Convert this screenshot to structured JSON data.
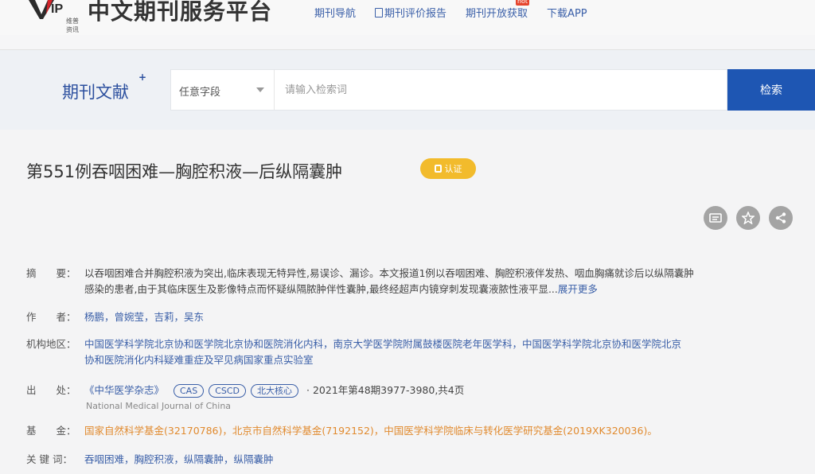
{
  "header": {
    "logo_text": "VIP",
    "logo_sub": "维普资讯",
    "site_title": "中文期刊服务平台",
    "nav": [
      {
        "label": "期刊导航"
      },
      {
        "label": "期刊评价报告"
      },
      {
        "label": "期刊开放获取",
        "badge": "hot"
      },
      {
        "label": "下载APP"
      }
    ]
  },
  "search": {
    "section_label": "期刊文献",
    "section_plus": "+",
    "field_select": "任意字段",
    "placeholder": "请输入检索词",
    "button_label": "检索"
  },
  "article": {
    "title": "第551例吞咽困难—胸腔积液—后纵隔囊肿",
    "oa_badge": "认证",
    "abstract_label": "摘　　要：",
    "abstract_line1": "以吞咽困难合并胸腔积液为突出,临床表现无特异性,易误诊、漏诊。本文报道1例以吞咽困难、胸腔积液伴发热、咽血胸痛就诊后以纵隔囊肿",
    "abstract_line2": "感染的患者,由于其临床医生及影像特点而怀疑纵隔脓肿伴性囊肿,最终经超声内镜穿刺发现囊液脓性液平显...",
    "abstract_more": "展开更多",
    "authors_label": "作　　者：",
    "authors": "杨鹏，曾婉莹，吉莉，吴东",
    "affiliation_label": "机构地区：",
    "affiliation_line1": "中国医学科学院北京协和医学院北京协和医院消化内科，南京大学医学院附属鼓楼医院老年医学科，中国医学科学院北京协和医学院北京",
    "affiliation_line2": "协和医院消化内科疑难重症及罕见病国家重点实验室",
    "source_label": "出　　处：",
    "source_journal": "《中华医学杂志》",
    "source_tags": [
      "CAS",
      "CSCD",
      "北大核心"
    ],
    "source_detail": "· 2021年第48期3977-3980,共4页",
    "source_en": "National Medical Journal of China",
    "fund_label": "基　　金：",
    "fund_text": "国家自然科学基金(32170786)，北京市自然科学基金(7192152)，中国医学科学院临床与转化医学研究基金(2019XK320036)。",
    "keywords_label": "关 键 词：",
    "keywords": "吞咽困难，胸腔积液，纵隔囊肿，纵隔囊肿"
  },
  "colors": {
    "accent_blue": "#1e56b3",
    "link_blue": "#3a5fa8",
    "badge_yellow": "#f2bb2c",
    "fund_orange": "#e18a2e"
  }
}
